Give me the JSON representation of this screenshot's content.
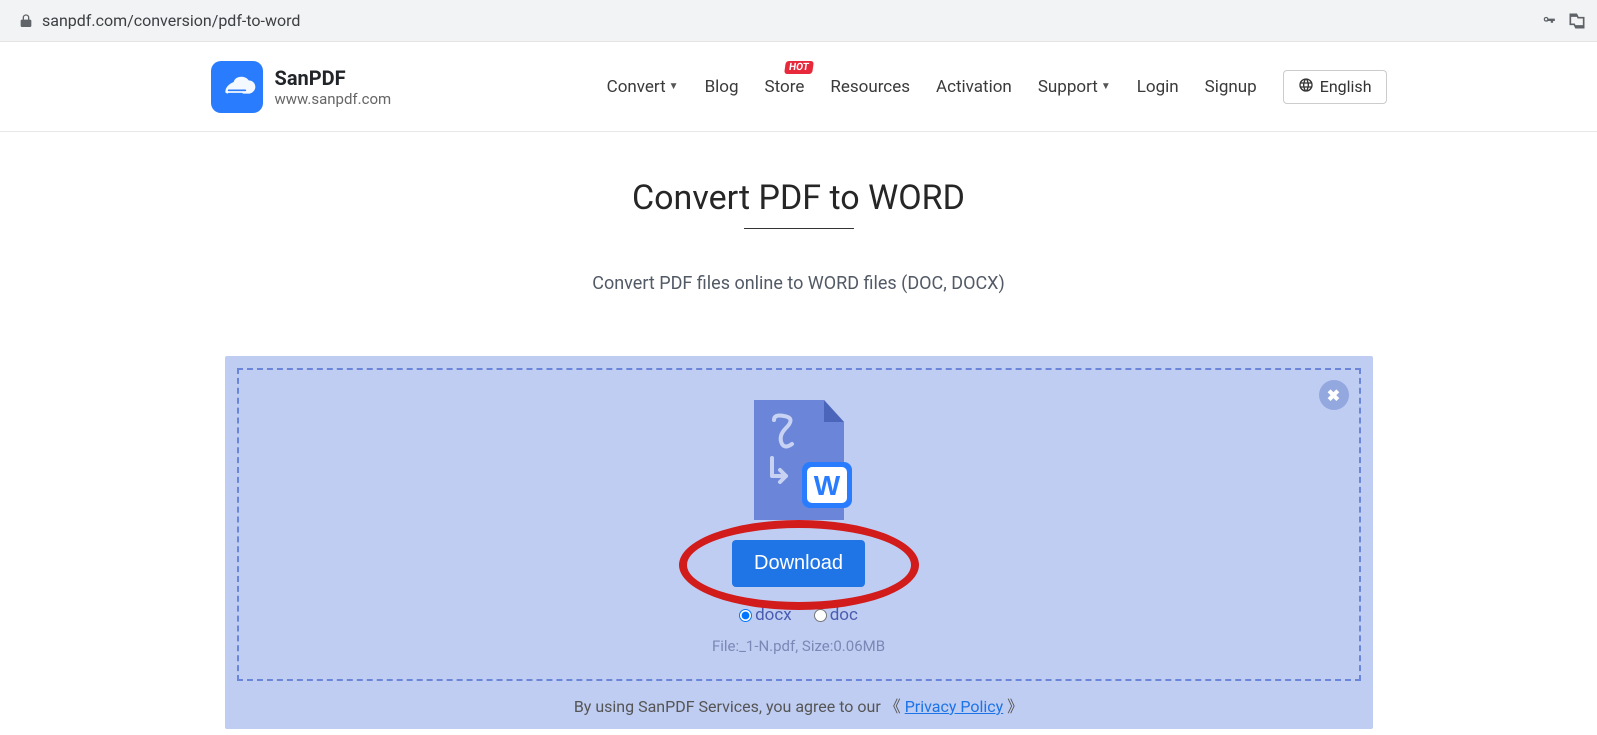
{
  "address_bar": {
    "url": "sanpdf.com/conversion/pdf-to-word"
  },
  "brand": {
    "name": "SanPDF",
    "domain": "www.sanpdf.com"
  },
  "nav": {
    "convert": "Convert",
    "blog": "Blog",
    "store": "Store",
    "store_badge": "HOT",
    "resources": "Resources",
    "activation": "Activation",
    "support": "Support",
    "login": "Login",
    "signup": "Signup"
  },
  "language": {
    "label": "English"
  },
  "page": {
    "title": "Convert PDF to WORD",
    "subtitle": "Convert PDF files online to WORD files (DOC, DOCX)"
  },
  "download": {
    "button_label": "Download",
    "format_options": {
      "docx": "docx",
      "doc": "doc"
    },
    "file_label": "File: ",
    "file_name": "_1-N.pdf",
    "size_label": " , Size: ",
    "file_size": "0.06MB"
  },
  "consent": {
    "prefix": "By using SanPDF Services, you agree to our ",
    "open_bracket": "《",
    "link_text": "Privacy Policy",
    "close_bracket": "》"
  }
}
